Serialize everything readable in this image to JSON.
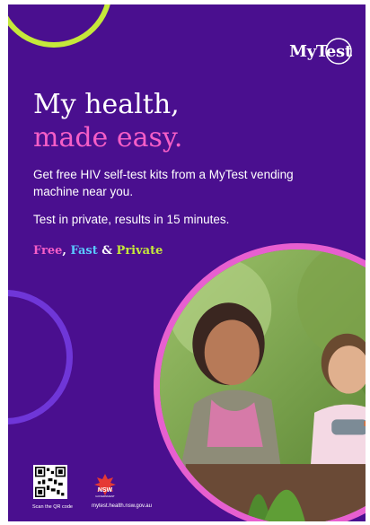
{
  "brand": {
    "logo_text": "MyTest",
    "colors": {
      "background": "#4a0f8f",
      "pink": "#f65ec7",
      "blue": "#5ac8ff",
      "lime": "#c5e83a",
      "violet": "#6f36d8"
    }
  },
  "headline": {
    "line1": "My health,",
    "line2": "made easy."
  },
  "body": {
    "paragraph1": "Get free HIV self-test kits from a MyTest vending machine near you.",
    "paragraph2": "Test in private, results in 15 minutes."
  },
  "tagline": {
    "free": "Free",
    "comma": ",",
    "fast": "Fast",
    "amp": "&",
    "private": "Private"
  },
  "footer": {
    "qr_label": "Scan the QR code",
    "nsw_logo_line1": "NSW",
    "nsw_logo_line2": "GOVERNMENT",
    "url": "mytest.health.nsw.gov.au"
  },
  "image": {
    "icon": "mother-and-child-gardening-photo"
  }
}
